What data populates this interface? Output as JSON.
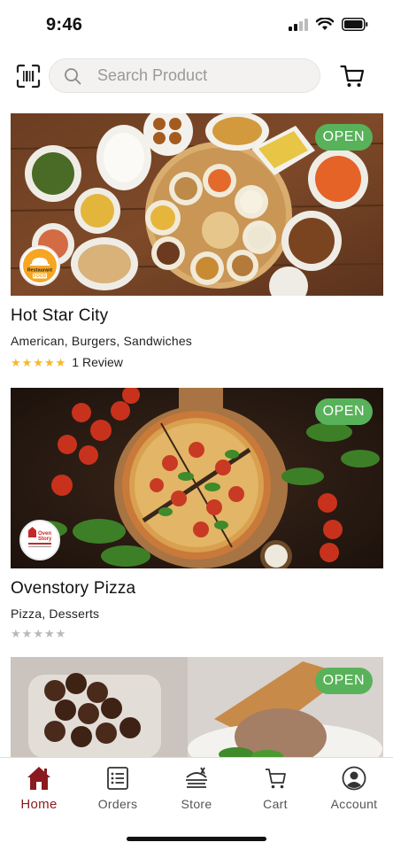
{
  "status_bar": {
    "time": "9:46"
  },
  "search": {
    "placeholder": "Search Product"
  },
  "restaurants": [
    {
      "name": "Hot Star City",
      "cuisine": "American, Burgers, Sandwiches",
      "status": "OPEN",
      "rating": 5,
      "review_text": "1 Review",
      "logo_text_top": "Restaurant",
      "logo_text_bottom": "FOOD"
    },
    {
      "name": "Ovenstory Pizza",
      "cuisine": "Pizza, Desserts",
      "status": "OPEN",
      "rating": 0,
      "review_text": "",
      "logo_text_top": "Oven",
      "logo_text_bottom": "Story"
    },
    {
      "name": "",
      "cuisine": "",
      "status": "OPEN",
      "rating": 0,
      "review_text": ""
    }
  ],
  "nav": {
    "items": [
      {
        "label": "Home",
        "icon": "home-icon",
        "active": true
      },
      {
        "label": "Orders",
        "icon": "orders-icon",
        "active": false
      },
      {
        "label": "Store",
        "icon": "store-icon",
        "active": false
      },
      {
        "label": "Cart",
        "icon": "cart-icon",
        "active": false
      },
      {
        "label": "Account",
        "icon": "account-icon",
        "active": false
      }
    ]
  },
  "colors": {
    "accent": "#8a1a1f",
    "open_badge": "#58b25a",
    "star_filled": "#f5b82e",
    "star_empty": "#b8b8b8"
  }
}
